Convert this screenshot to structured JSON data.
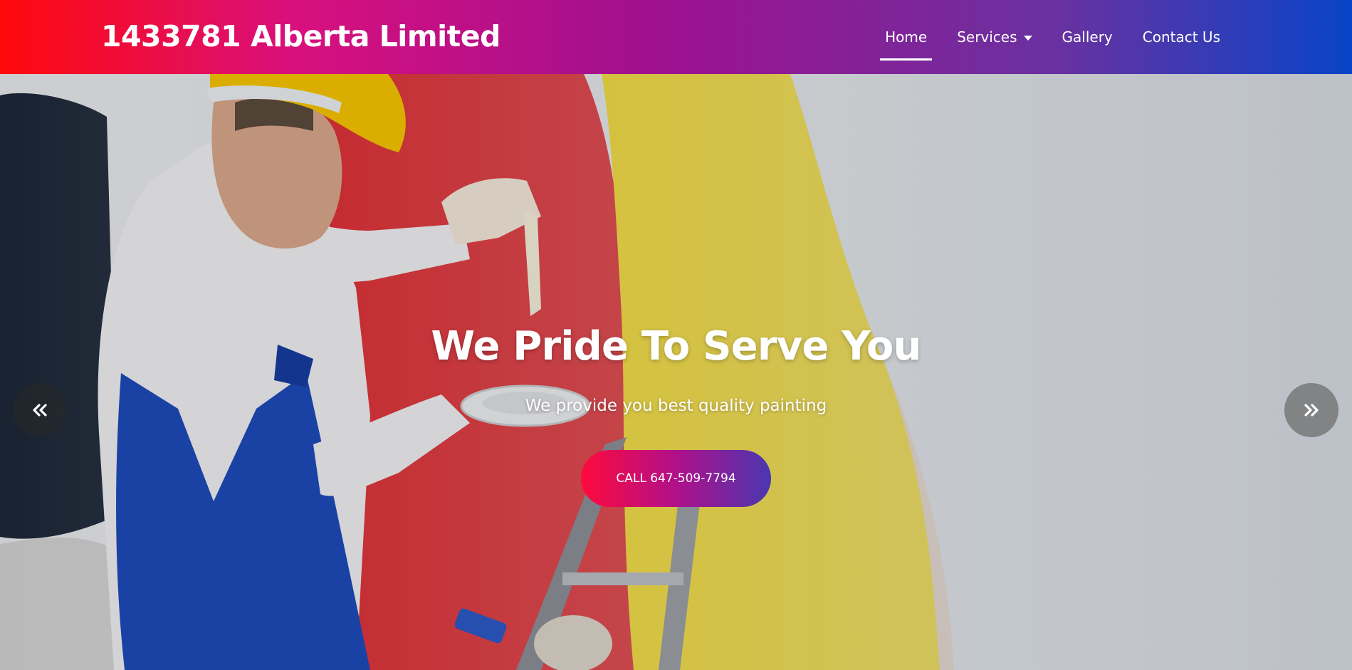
{
  "header": {
    "brand": "1433781 Alberta Limited",
    "nav": [
      {
        "label": "Home",
        "active": true
      },
      {
        "label": "Services",
        "has_dropdown": true
      },
      {
        "label": "Gallery"
      },
      {
        "label": "Contact Us"
      }
    ],
    "gradient": [
      "#ff0a0a",
      "#d8107e",
      "#a0108f",
      "#6a31a0",
      "#0844c7"
    ]
  },
  "hero": {
    "title": "We Pride To Serve You",
    "subtitle": "We provide you best quality painting",
    "cta_label": "CALL 647-509-7794",
    "prev_icon": "chevron-double-left-icon",
    "next_icon": "chevron-double-right-icon"
  }
}
